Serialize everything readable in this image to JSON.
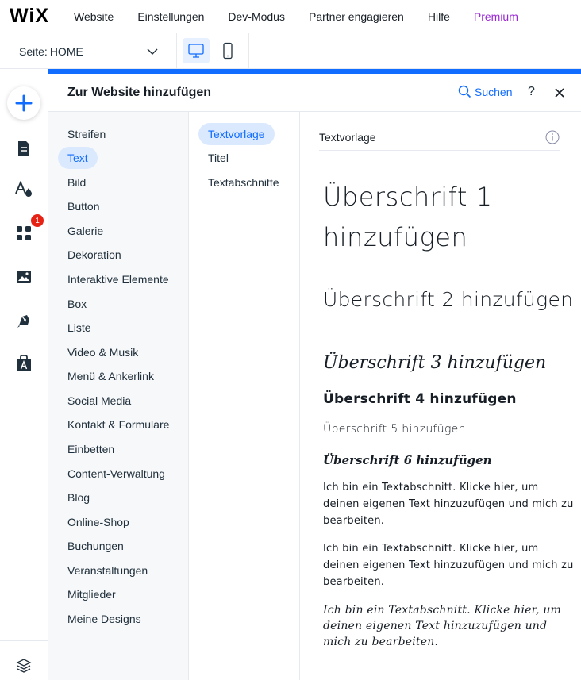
{
  "topbar": {
    "logo": "WiX",
    "nav": [
      "Website",
      "Einstellungen",
      "Dev-Modus",
      "Partner engagieren",
      "Hilfe"
    ],
    "premium": "Premium",
    "premium_color": "#9a27d5"
  },
  "secondbar": {
    "page_label": "Seite:",
    "page_value": "HOME",
    "device_icons": [
      "desktop-icon",
      "mobile-icon"
    ]
  },
  "rail": {
    "icons": [
      "add-icon",
      "pages-icon",
      "theme-icon",
      "apps-icon",
      "media-icon",
      "pen-icon",
      "business-icon",
      "layers-icon"
    ],
    "apps_badge": "1"
  },
  "panel": {
    "title": "Zur Website hinzufügen",
    "search_label": "Suchen",
    "help_label": "?",
    "accent_color": "#116dff",
    "categories": [
      "Streifen",
      "Text",
      "Bild",
      "Button",
      "Galerie",
      "Dekoration",
      "Interaktive Elemente",
      "Box",
      "Liste",
      "Video & Musik",
      "Menü & Ankerlink",
      "Social Media",
      "Kontakt & Formulare",
      "Einbetten",
      "Content-Verwaltung",
      "Blog",
      "Online-Shop",
      "Buchungen",
      "Veranstaltungen",
      "Mitglieder",
      "Meine Designs"
    ],
    "active_category": "Text",
    "subcategories": [
      "Textvorlage",
      "Titel",
      "Textabschnitte"
    ],
    "active_subcategory": "Textvorlage"
  },
  "preview": {
    "section_title": "Textvorlage",
    "h1": "Überschrift 1 hinzufügen",
    "h2": "Überschrift 2 hinzufügen",
    "h3": "Überschrift 3 hinzufügen",
    "h4": "Überschrift 4 hinzufügen",
    "h5": "Überschrift 5 hinzufügen",
    "h6": "Überschrift 6 hinzufügen",
    "p1": "Ich bin ein Textabschnitt. Klicke hier, um deinen eigenen Text hinzuzufügen und mich zu bearbeiten.",
    "p2": "Ich bin ein Textabschnitt. Klicke hier, um deinen eigenen Text hinzuzufügen und mich zu bearbeiten.",
    "p3": "Ich bin ein Textabschnitt. Klicke hier, um deinen eigenen Text hinzuzufügen und mich zu bearbeiten."
  }
}
